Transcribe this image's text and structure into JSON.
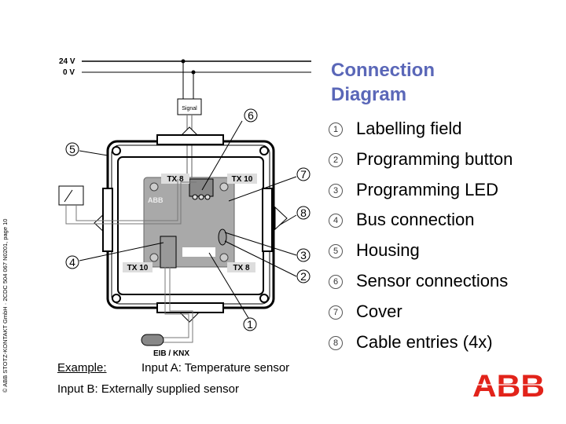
{
  "footer_copyright": "© ABB STOTZ-KONTAKT GmbH · 2CDC 504 067 N0201, page 10",
  "title_line1": "Connection",
  "title_line2": "Diagram",
  "legend": [
    {
      "num": "1",
      "label": "Labelling field"
    },
    {
      "num": "2",
      "label": "Programming button"
    },
    {
      "num": "3",
      "label": "Programming LED"
    },
    {
      "num": "4",
      "label": "Bus connection"
    },
    {
      "num": "5",
      "label": "Housing"
    },
    {
      "num": "6",
      "label": "Sensor connections"
    },
    {
      "num": "7",
      "label": "Cover"
    },
    {
      "num": "8",
      "label": "Cable entries (4x)"
    }
  ],
  "diagram": {
    "supply_24v": "24 V",
    "supply_0v": "0 V",
    "signal_box": "Signal",
    "tx8": "TX 8",
    "tx10": "TX 10",
    "bus_label": "EIB / KNX",
    "device_brand": "ABB"
  },
  "example_label": "Example:",
  "input_a": "Input A: Temperature sensor",
  "input_b": "Input B: Externally supplied sensor",
  "logo_text": "ABB",
  "colors": {
    "title": "#5a67b8",
    "logo": "#e2231a",
    "plate": "#a9a9a9"
  }
}
